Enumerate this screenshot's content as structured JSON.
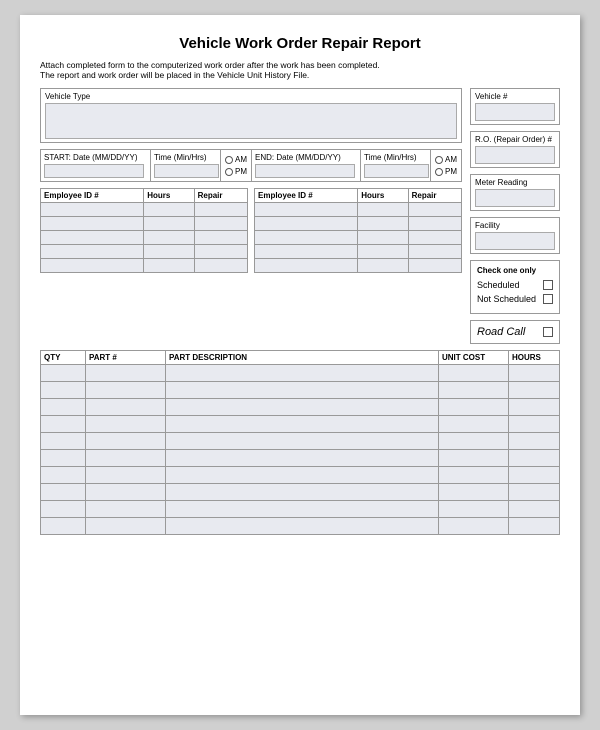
{
  "page": {
    "title": "Vehicle Work Order Repair Report",
    "instructions": {
      "line1": "Attach completed form to the computerized work order after the work has been completed.",
      "line2": "The report and work order will be placed in the Vehicle Unit History File."
    }
  },
  "right_panel": {
    "vehicle_label": "Vehicle #",
    "ro_label": "R.O. (Repair Order) #",
    "meter_label": "Meter Reading",
    "facility_label": "Facility"
  },
  "vehicle_type": {
    "label": "Vehicle Type"
  },
  "datetime": {
    "start_label": "START: Date (MM/DD/YY)",
    "start_time_label": "Time (Min/Hrs)",
    "am_label": "AM",
    "pm_label": "PM",
    "end_label": "END: Date (MM/DD/YY)",
    "end_time_label": "Time (Min/Hrs)"
  },
  "employee_table": {
    "col1": "Employee ID #",
    "col2": "Hours",
    "col3": "Repair",
    "rows": 5
  },
  "check_section": {
    "title": "Check one only",
    "scheduled": "Scheduled",
    "not_scheduled": "Not Scheduled"
  },
  "road_call": {
    "label": "Road Call"
  },
  "parts_table": {
    "col_qty": "QTY",
    "col_part": "PART #",
    "col_desc": "PART DESCRIPTION",
    "col_unit": "UNIT COST",
    "col_hours": "HOURS",
    "rows": 10
  }
}
